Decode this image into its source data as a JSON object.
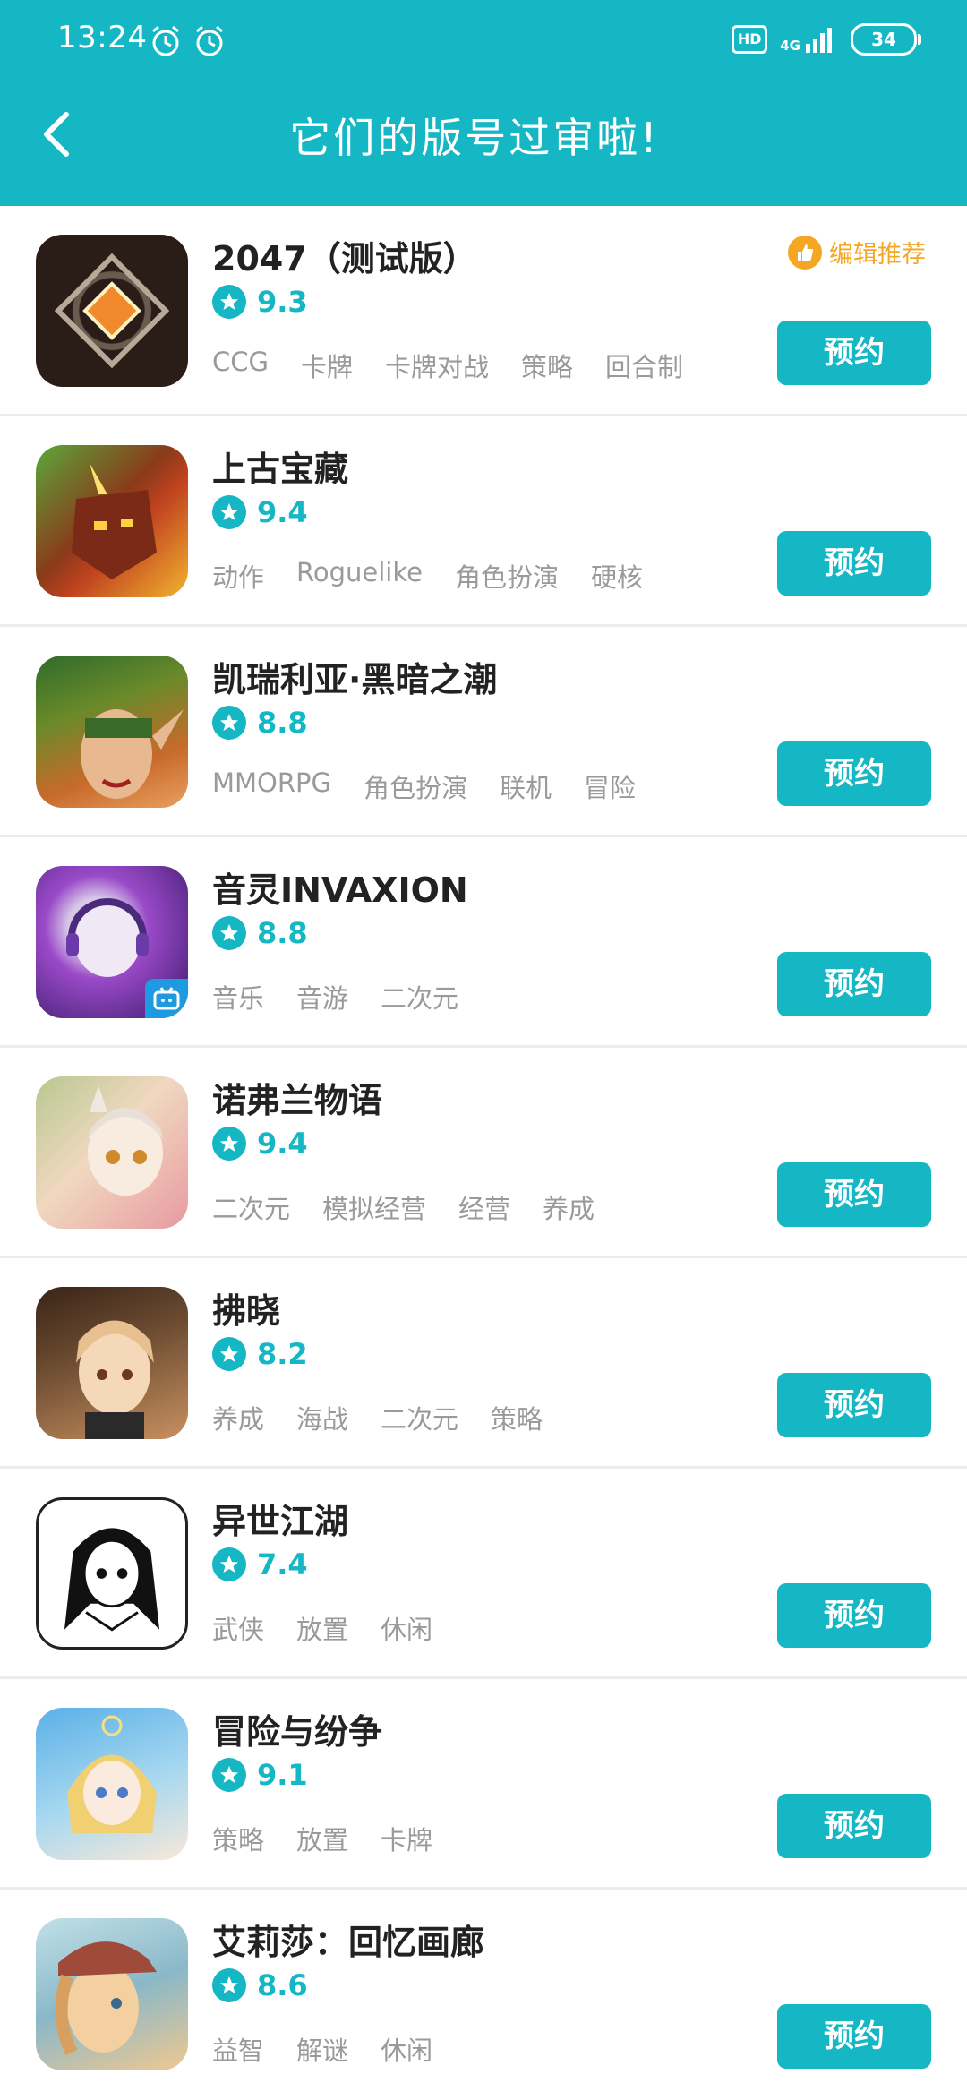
{
  "status_bar": {
    "time": "13:24",
    "hd": "HD",
    "network": "4G",
    "battery": "34"
  },
  "header": {
    "title": "它们的版号过审啦!"
  },
  "games": [
    {
      "name": "2047（测试版）",
      "rating": "9.3",
      "tags": [
        "CCG",
        "卡牌",
        "卡牌对战",
        "策略",
        "回合制"
      ],
      "editor_pick": "编辑推荐",
      "button": "预约",
      "icon_colors": [
        "#3a2a22",
        "#e07a2c",
        "#1a1412"
      ]
    },
    {
      "name": "上古宝藏",
      "rating": "9.4",
      "tags": [
        "动作",
        "Roguelike",
        "角色扮演",
        "硬核"
      ],
      "button": "预约",
      "icon_colors": [
        "#5aa83a",
        "#c0421f",
        "#f2b430"
      ]
    },
    {
      "name": "凯瑞利亚·黑暗之潮",
      "rating": "8.8",
      "tags": [
        "MMORPG",
        "角色扮演",
        "联机",
        "冒险"
      ],
      "button": "预约",
      "icon_colors": [
        "#2f6b2a",
        "#c86a2a",
        "#e8a060"
      ]
    },
    {
      "name": "音灵INVAXION",
      "rating": "8.8",
      "tags": [
        "音乐",
        "音游",
        "二次元"
      ],
      "button": "预约",
      "icon_colors": [
        "#5a2a8a",
        "#d8c8e8",
        "#9a4ac8"
      ]
    },
    {
      "name": "诺弗兰物语",
      "rating": "9.4",
      "tags": [
        "二次元",
        "模拟经营",
        "经营",
        "养成"
      ],
      "button": "预约",
      "icon_colors": [
        "#f0d8c0",
        "#e89aa0",
        "#b8c890"
      ]
    },
    {
      "name": "拂晓",
      "rating": "8.2",
      "tags": [
        "养成",
        "海战",
        "二次元",
        "策略"
      ],
      "button": "预约",
      "icon_colors": [
        "#3a2418",
        "#e8c090",
        "#c89060"
      ]
    },
    {
      "name": "异世江湖",
      "rating": "7.4",
      "tags": [
        "武侠",
        "放置",
        "休闲"
      ],
      "button": "预约",
      "icon_colors": [
        "#ffffff",
        "#111111",
        "#888888"
      ]
    },
    {
      "name": "冒险与纷争",
      "rating": "9.1",
      "tags": [
        "策略",
        "放置",
        "卡牌"
      ],
      "button": "预约",
      "icon_colors": [
        "#5ab0e8",
        "#f0d070",
        "#f8e8d8"
      ]
    },
    {
      "name": "艾莉莎：回忆画廊",
      "rating": "8.6",
      "tags": [
        "益智",
        "解谜",
        "休闲"
      ],
      "button": "预约",
      "icon_colors": [
        "#c0e0e8",
        "#a04a3a",
        "#f0c890"
      ]
    }
  ]
}
